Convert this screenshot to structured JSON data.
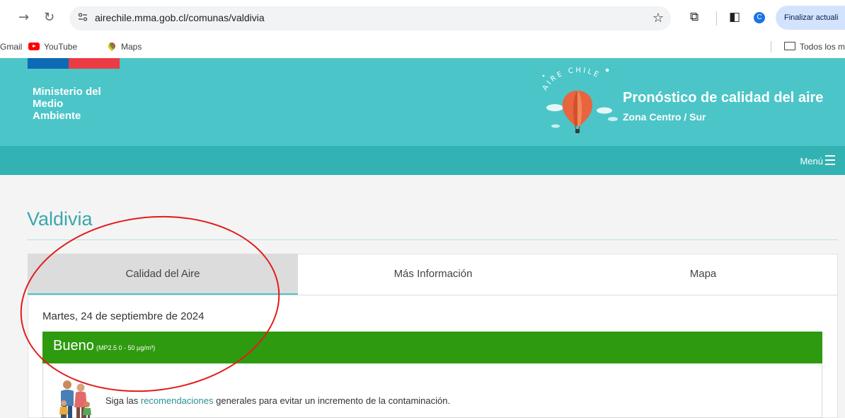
{
  "browser": {
    "url": "airechile.mma.gob.cl/comunas/valdivia",
    "update_button": "Finalizar actuali",
    "avatar_letter": "C"
  },
  "bookmarks": {
    "items": [
      "Gmail",
      "YouTube",
      "Maps"
    ],
    "all_bookmarks": "Todos los m"
  },
  "header": {
    "ministry_lines": [
      "Ministerio del",
      "Medio",
      "Ambiente"
    ],
    "logo_text": "AIRE CHILE",
    "title": "Pronóstico de calidad del aire",
    "subtitle": "Zona Centro / Sur",
    "menu_label": "Menú"
  },
  "page": {
    "city": "Valdivia",
    "tabs": [
      "Calidad del Aire",
      "Más Información",
      "Mapa"
    ],
    "active_tab": 0,
    "date": "Martes, 24 de septiembre de 2024",
    "status": {
      "label": "Bueno",
      "range": "(MP2.5 0 - 50 µg/m³)",
      "color": "#2e9a0f"
    },
    "recommendation": {
      "prefix": "Siga las ",
      "link": "recomendaciones",
      "suffix": " generales para evitar un incremento de la contaminación."
    }
  },
  "colors": {
    "header_bg": "#4bc5c8",
    "nav_bg": "#32b2b3",
    "title_color": "#3ba7ab",
    "annotation": "#e31b1b"
  }
}
